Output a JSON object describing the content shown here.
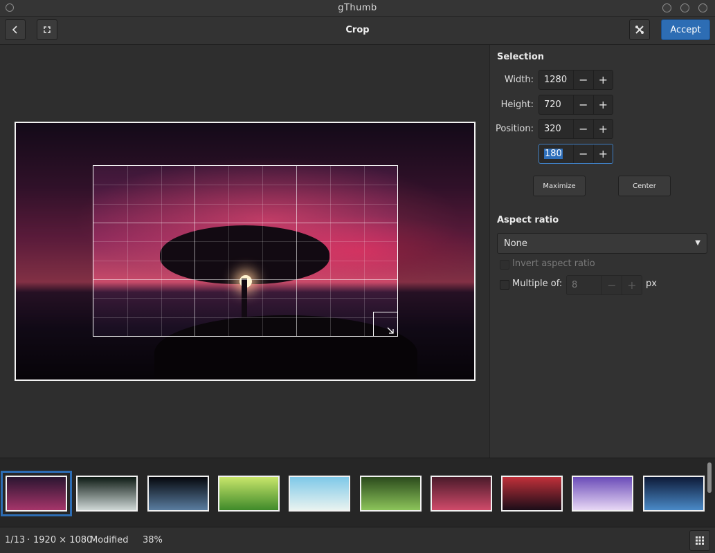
{
  "window": {
    "title": "gThumb"
  },
  "header": {
    "title": "Crop",
    "accept_label": "Accept",
    "back_icon": "back-arrow-icon",
    "fullscreen_icon": "fullscreen-icon",
    "tools_icon": "tools-icon"
  },
  "selection": {
    "title": "Selection",
    "width_label": "Width:",
    "width_value": "1280",
    "height_label": "Height:",
    "height_value": "720",
    "position_label": "Position:",
    "position_x": "320",
    "position_y": "180",
    "minus": "−",
    "plus": "+",
    "maximize_label": "Maximize",
    "center_label": "Center"
  },
  "aspect": {
    "title": "Aspect ratio",
    "selected": "None",
    "invert_label": "Invert aspect ratio",
    "multiple_label": "Multiple of:",
    "multiple_value": "8",
    "unit": "px"
  },
  "filmstrip": {
    "thumbnails": [
      {
        "name": "tree-sunset",
        "colors": [
          "#2a1530",
          "#a6356a"
        ]
      },
      {
        "name": "waterfall",
        "colors": [
          "#0d1a14",
          "#cfd8d6"
        ]
      },
      {
        "name": "planet",
        "colors": [
          "#05070c",
          "#5a7da0"
        ]
      },
      {
        "name": "leaves",
        "colors": [
          "#c9e66b",
          "#3f8a2a"
        ]
      },
      {
        "name": "beach",
        "colors": [
          "#7ec8e8",
          "#e9f3f0"
        ]
      },
      {
        "name": "forest-path",
        "colors": [
          "#2b4a1c",
          "#8cc45a"
        ]
      },
      {
        "name": "mountain",
        "colors": [
          "#4a1a2a",
          "#d04a6a"
        ]
      },
      {
        "name": "red-sunset",
        "colors": [
          "#c0303a",
          "#1b0d18"
        ]
      },
      {
        "name": "purple-forest",
        "colors": [
          "#6a4bb8",
          "#e8d8f5"
        ]
      },
      {
        "name": "night-sky",
        "colors": [
          "#0d1a38",
          "#4a8ac8"
        ]
      }
    ]
  },
  "status": {
    "position": "1/13",
    "dimensions": "1920 × 1080",
    "state": "Modified",
    "zoom": "38%",
    "sep": "·"
  }
}
